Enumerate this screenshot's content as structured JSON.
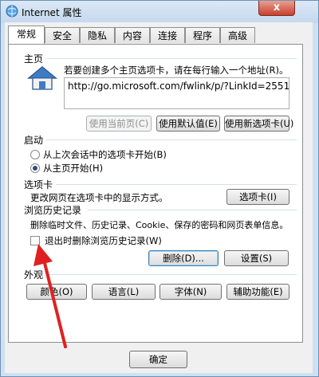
{
  "window": {
    "title": "Internet 属性",
    "close_label": "x"
  },
  "tabs": [
    {
      "label": "常规",
      "active": true
    },
    {
      "label": "安全",
      "active": false
    },
    {
      "label": "隐私",
      "active": false
    },
    {
      "label": "内容",
      "active": false
    },
    {
      "label": "连接",
      "active": false
    },
    {
      "label": "程序",
      "active": false
    },
    {
      "label": "高级",
      "active": false
    }
  ],
  "home": {
    "group_label": "主页",
    "instruction": "若要创建多个主页选项卡，请在每行输入一个地址(R)。",
    "url": "http://go.microsoft.com/fwlink/p/?LinkId=2551",
    "use_current": "使用当前页(C)",
    "use_default": "使用默认值(E)",
    "use_new_tab": "使用新选项卡(U)"
  },
  "startup": {
    "group_label": "启动",
    "option_last_session": "从上次会话中的选项卡开始(B)",
    "option_home": "从主页开始(H)",
    "selected": "option_home"
  },
  "tabs_section": {
    "group_label": "选项卡",
    "description": "更改网页在选项卡中的显示方式。",
    "button": "选项卡(I)"
  },
  "history": {
    "group_label": "浏览历史记录",
    "description": "删除临时文件、历史记录、Cookie、保存的密码和网页表单信息。",
    "checkbox_label": "退出时删除浏览历史记录(W)",
    "checkbox_checked": false,
    "delete_button": "删除(D)...",
    "settings_button": "设置(S)"
  },
  "appearance": {
    "group_label": "外观",
    "colors_button": "颜色(O)",
    "languages_button": "语言(L)",
    "fonts_button": "字体(N)",
    "accessibility_button": "辅助功能(E)"
  },
  "footer": {
    "ok_button": "确定"
  },
  "colors": {
    "annotation_arrow": "#e02020",
    "accent": "#3c7fb1"
  }
}
